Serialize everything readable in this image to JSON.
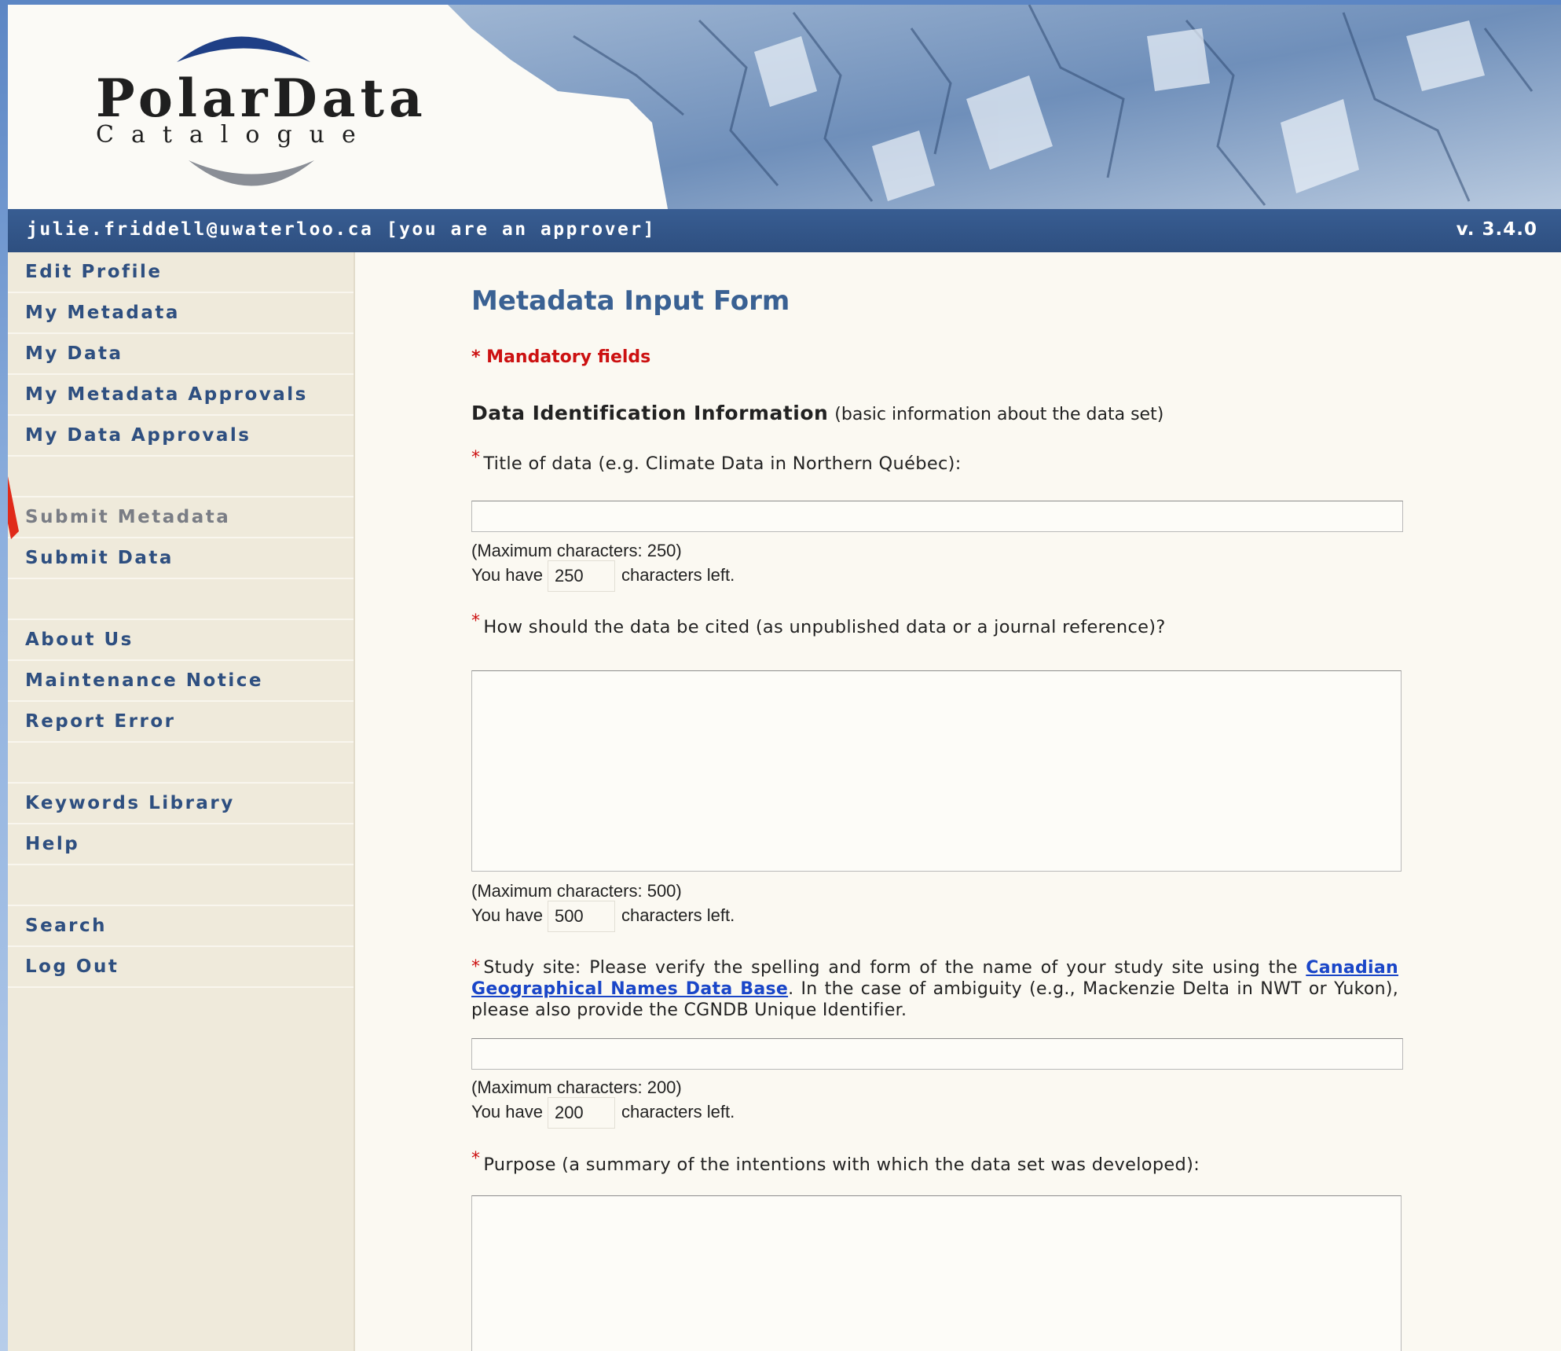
{
  "header": {
    "logo": {
      "word1": "Polar",
      "word2": "Data",
      "word3": "Catalogue"
    },
    "user_text": "julie.friddell@uwaterloo.ca [you are an approver]",
    "version": "v. 3.4.0"
  },
  "sidebar": {
    "groups": [
      [
        {
          "label": "Edit Profile"
        },
        {
          "label": "My Metadata"
        },
        {
          "label": "My Data"
        },
        {
          "label": "My Metadata Approvals"
        },
        {
          "label": "My Data Approvals"
        }
      ],
      [
        {
          "label": "Submit Metadata",
          "disabled": true
        },
        {
          "label": "Submit Data"
        }
      ],
      [
        {
          "label": "About Us"
        },
        {
          "label": "Maintenance Notice"
        },
        {
          "label": "Report Error"
        }
      ],
      [
        {
          "label": "Keywords Library"
        },
        {
          "label": "Help"
        }
      ],
      [
        {
          "label": "Search"
        },
        {
          "label": "Log Out"
        }
      ]
    ]
  },
  "form": {
    "title": "Metadata Input Form",
    "mandatory_note": "* Mandatory fields",
    "section_title": "Data Identification Information",
    "section_subtitle": "(basic information about the data set)",
    "required_marker": "*",
    "fields": {
      "title": {
        "label": "Title of data (e.g. Climate Data in Northern Québec):",
        "value": "",
        "max_note": "(Maximum characters: 250)",
        "you_have": "You have",
        "remaining": "250",
        "chars_left": "characters left."
      },
      "citation": {
        "label": "How should the data be cited (as unpublished data or a journal reference)?",
        "value": "",
        "max_note": "(Maximum characters: 500)",
        "you_have": "You have",
        "remaining": "500",
        "chars_left": "characters left."
      },
      "study_site": {
        "text_before": "Study site: Please verify the spelling and form of the name of your study site using the",
        "link_text": "Canadian Geographical Names Data Base",
        "text_after": ". In the case of ambiguity (e.g., Mackenzie Delta in NWT or Yukon), please also provide the CGNDB Unique Identifier.",
        "value": "",
        "max_note": "(Maximum characters: 200)",
        "you_have": "You have",
        "remaining": "200",
        "chars_left": "characters left."
      },
      "purpose": {
        "label": "Purpose (a summary of the intentions with which the data set was developed):",
        "value": ""
      }
    }
  },
  "colors": {
    "nav_text": "#2e4f80",
    "userbar": "#2e4f80",
    "title": "#3a6193",
    "required": "#cc1111",
    "link": "#1a46c8",
    "sidebar_bg": "#efeadb"
  }
}
